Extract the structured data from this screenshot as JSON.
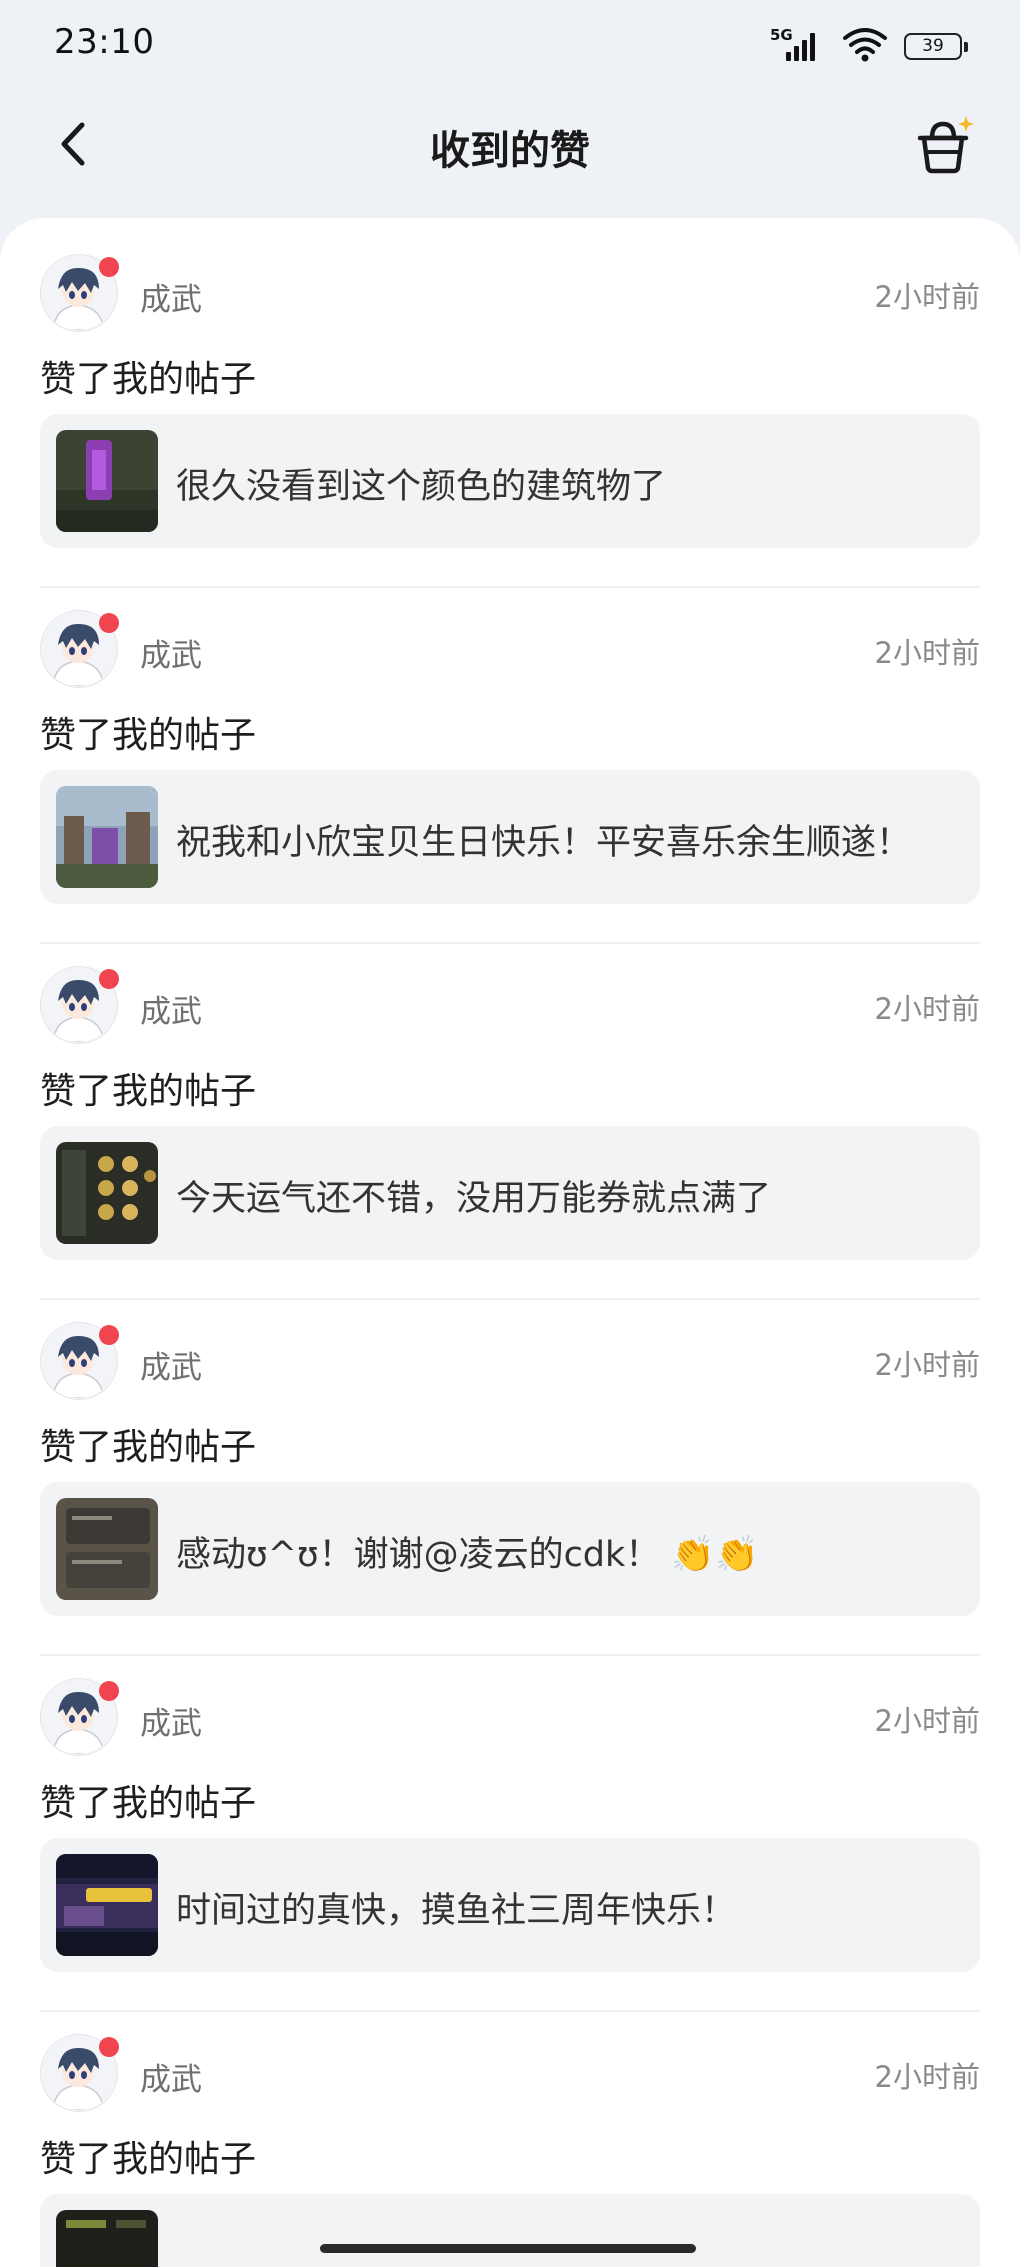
{
  "status_bar": {
    "time": "23:10",
    "network": "5G",
    "battery": "39"
  },
  "header": {
    "title": "收到的赞"
  },
  "likes": [
    {
      "user": "成武",
      "time": "2小时前",
      "action": "赞了我的帖子",
      "post_text": "很久没看到这个颜色的建筑物了"
    },
    {
      "user": "成武",
      "time": "2小时前",
      "action": "赞了我的帖子",
      "post_text": "祝我和小欣宝贝生日快乐！平安喜乐余生顺遂！"
    },
    {
      "user": "成武",
      "time": "2小时前",
      "action": "赞了我的帖子",
      "post_text": "今天运气还不错，没用万能券就点满了"
    },
    {
      "user": "成武",
      "time": "2小时前",
      "action": "赞了我的帖子",
      "post_text": "感动ʊ^ʊ！谢谢@凌云的cdk！ 👏👏"
    },
    {
      "user": "成武",
      "time": "2小时前",
      "action": "赞了我的帖子",
      "post_text": "时间过的真快，摸鱼社三周年快乐！"
    },
    {
      "user": "成武",
      "time": "2小时前",
      "action": "赞了我的帖子",
      "post_text": ""
    }
  ]
}
